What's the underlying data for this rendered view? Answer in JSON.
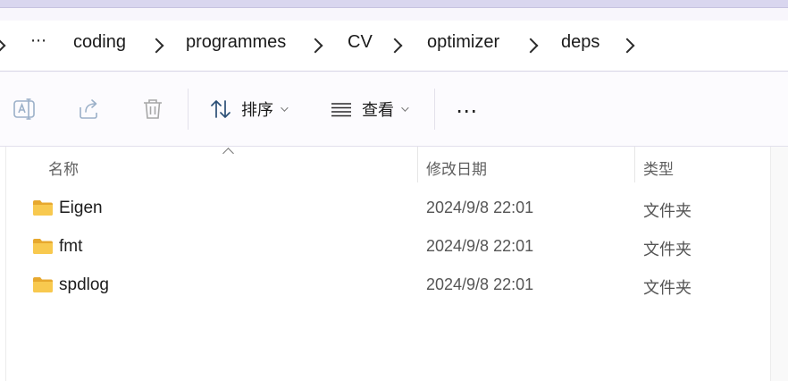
{
  "breadcrumb": {
    "overflow": "⋯",
    "items": [
      "coding",
      "programmes",
      "CV",
      "optimizer",
      "deps"
    ]
  },
  "toolbar": {
    "sort_label": "排序",
    "view_label": "查看",
    "more": "⋯",
    "icons": [
      "rename-icon",
      "share-icon",
      "delete-icon",
      "sort-icon",
      "view-icon"
    ]
  },
  "columns": {
    "name": "名称",
    "modified": "修改日期",
    "type": "类型"
  },
  "files": [
    {
      "name": "Eigen",
      "modified": "2024/9/8 22:01",
      "type": "文件夹"
    },
    {
      "name": "fmt",
      "modified": "2024/9/8 22:01",
      "type": "文件夹"
    },
    {
      "name": "spdlog",
      "modified": "2024/9/8 22:01",
      "type": "文件夹"
    }
  ],
  "colors": {
    "folder": "#f7c54a",
    "folder_dark": "#e7a82e",
    "accent_strip": "#d9d6ef"
  }
}
